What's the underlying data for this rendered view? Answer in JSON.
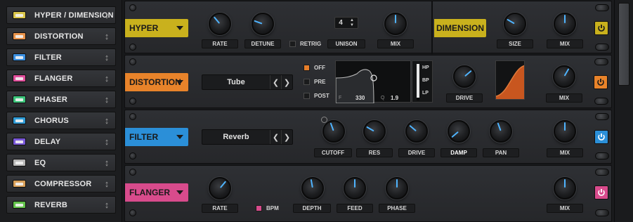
{
  "sidebar": {
    "items": [
      {
        "label": "HYPER / DIMENSION",
        "color": "#d9c54a"
      },
      {
        "label": "DISTORTION",
        "color": "#e8924a"
      },
      {
        "label": "FILTER",
        "color": "#3b8fe0"
      },
      {
        "label": "FLANGER",
        "color": "#e04f9c"
      },
      {
        "label": "PHASER",
        "color": "#3cc47a"
      },
      {
        "label": "CHORUS",
        "color": "#2f9bd6"
      },
      {
        "label": "DELAY",
        "color": "#7a58d8"
      },
      {
        "label": "EQ",
        "color": "#b8b8b8"
      },
      {
        "label": "COMPRESSOR",
        "color": "#d9a05a"
      },
      {
        "label": "REVERB",
        "color": "#62c24a"
      }
    ]
  },
  "hyper": {
    "title": "HYPER",
    "rate_label": "RATE",
    "detune_label": "DETUNE",
    "retrig_label": "RETRIG",
    "unison_label": "UNISON",
    "unison_value": "4",
    "mix_label": "MIX"
  },
  "dimension": {
    "title": "DIMENSION",
    "size_label": "SIZE",
    "mix_label": "MIX"
  },
  "distortion": {
    "title": "DISTORTION",
    "type_value": "Tube",
    "mode_off": "OFF",
    "mode_pre": "PRE",
    "mode_post": "POST",
    "freq_label": "F",
    "freq_value": "330",
    "q_label": "Q",
    "q_value": "1.9",
    "filter_hp": "HP",
    "filter_bp": "BP",
    "filter_lp": "LP",
    "drive_label": "DRIVE",
    "mix_label": "MIX"
  },
  "filter": {
    "title": "FILTER",
    "type_value": "Reverb",
    "cutoff_label": "CUTOFF",
    "res_label": "RES",
    "drive_label": "DRIVE",
    "damp_label": "DAMP",
    "pan_label": "PAN",
    "mix_label": "MIX"
  },
  "flanger": {
    "title": "FLANGER",
    "rate_label": "RATE",
    "bpm_label": "BPM",
    "depth_label": "DEPTH",
    "feed_label": "FEED",
    "phase_label": "PHASE",
    "mix_label": "MIX"
  },
  "colors": {
    "hyper": "#c9b11d",
    "distortion": "#e8832a",
    "filter": "#2b8fd8",
    "flanger": "#d84b8c",
    "knob_indicator": "#4fb4ff"
  }
}
